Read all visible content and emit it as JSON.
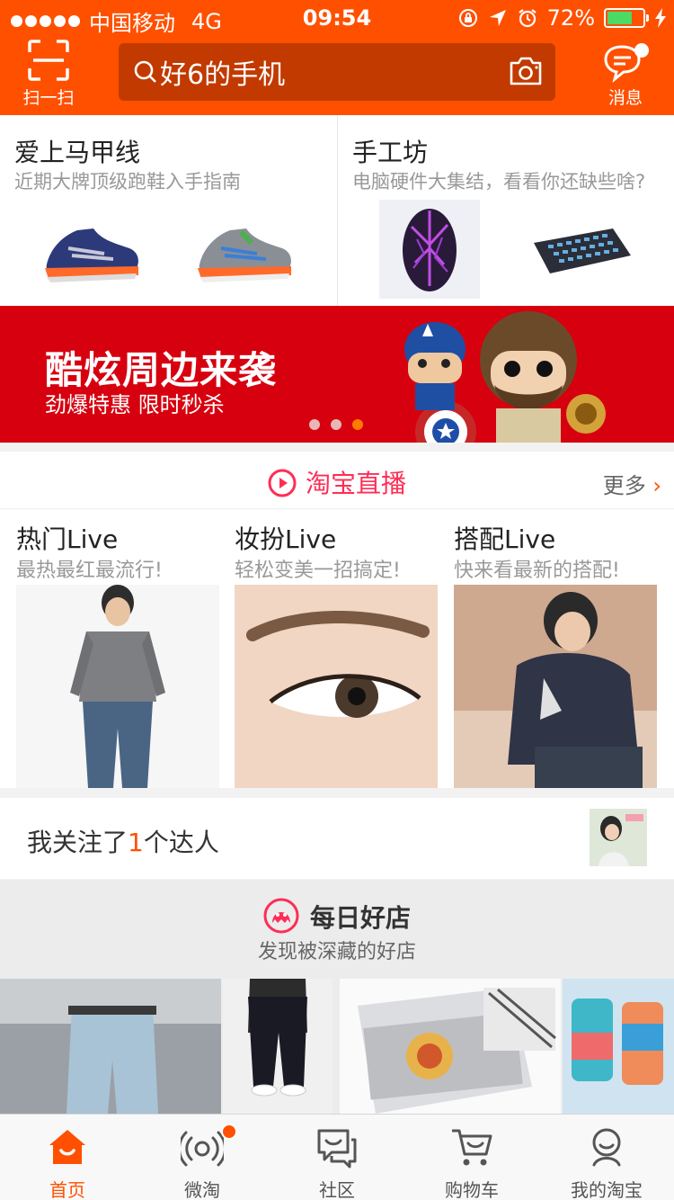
{
  "status_bar": {
    "carrier": "中国移动",
    "network": "4G",
    "time": "09:54",
    "battery": "72%",
    "battery_level": 0.72
  },
  "header": {
    "scan_label": "扫一扫",
    "search_text": "好6的手机",
    "message_label": "消息"
  },
  "promo": [
    {
      "title": "爱上马甲线",
      "subtitle": "近期大牌顶级跑鞋入手指南"
    },
    {
      "title": "手工坊",
      "subtitle": "电脑硬件大集结，看看你还缺些啥?"
    }
  ],
  "banner": {
    "headline": "酷炫周边来袭",
    "subline": "劲爆特惠 限时秒杀",
    "page_count": 3,
    "active_page": 3
  },
  "live": {
    "title": "淘宝直播",
    "more": "更多",
    "cards": [
      {
        "title": "热门Live",
        "desc": "最热最红最流行!"
      },
      {
        "title": "妆扮Live",
        "desc": "轻松变美一招搞定!"
      },
      {
        "title": "搭配Live",
        "desc": "快来看最新的搭配!"
      }
    ]
  },
  "follow": {
    "prefix": "我关注了",
    "count": "1",
    "suffix": "个达人"
  },
  "daily_shop": {
    "title": "每日好店",
    "subtitle": "发现被深藏的好店"
  },
  "tabbar": {
    "tabs": [
      {
        "label": "首页",
        "icon": "home-icon",
        "active": true
      },
      {
        "label": "微淘",
        "icon": "broadcast-icon"
      },
      {
        "label": "社区",
        "icon": "chat-bubbles-icon"
      },
      {
        "label": "购物车",
        "icon": "cart-icon"
      },
      {
        "label": "我的淘宝",
        "icon": "profile-icon"
      }
    ]
  },
  "colors": {
    "brand": "#ff5000",
    "search_bg": "#c23a00",
    "banner_bg": "#d7000f",
    "live_accent": "#ff2d55"
  }
}
